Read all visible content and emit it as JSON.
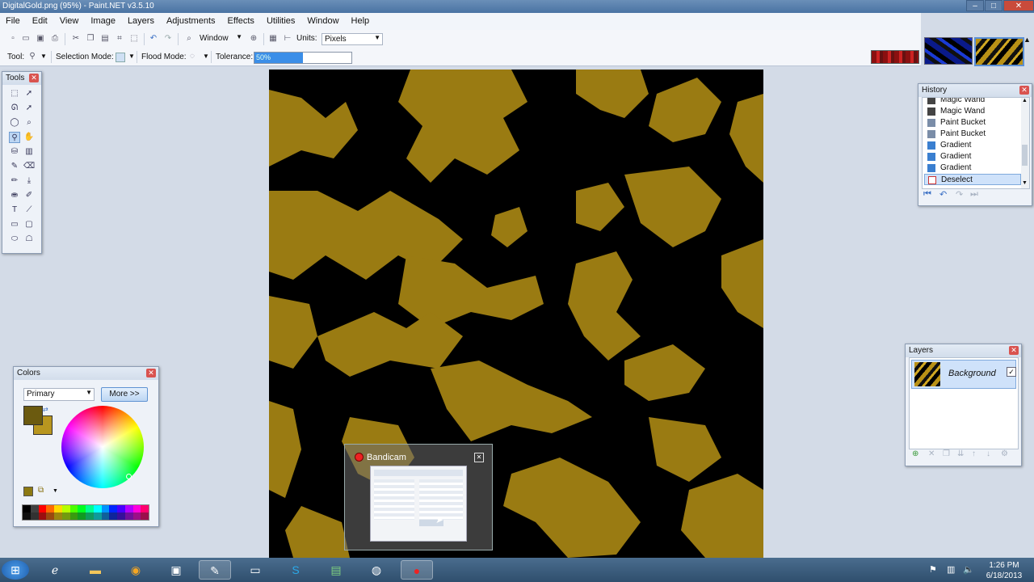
{
  "window": {
    "title": "DigitalGold.png (95%) - Paint.NET v3.5.10"
  },
  "menu": {
    "items": [
      "File",
      "Edit",
      "View",
      "Image",
      "Layers",
      "Adjustments",
      "Effects",
      "Utilities",
      "Window",
      "Help"
    ]
  },
  "toolbar": {
    "zoom_label": "Window",
    "units_label": "Units:",
    "units_value": "Pixels",
    "tool_label": "Tool:",
    "selection_mode_label": "Selection Mode:",
    "flood_mode_label": "Flood Mode:",
    "tolerance_label": "Tolerance:",
    "tolerance_value": "50%",
    "tolerance_fraction": 0.5
  },
  "tools": {
    "title": "Tools"
  },
  "history": {
    "title": "History",
    "items": [
      "Magic Wand",
      "Magic Wand",
      "Paint Bucket",
      "Paint Bucket",
      "Gradient",
      "Gradient",
      "Gradient",
      "Deselect"
    ],
    "selected_index": 7
  },
  "layers": {
    "title": "Layers",
    "items": [
      {
        "name": "Background",
        "visible": true
      }
    ]
  },
  "colors": {
    "title": "Colors",
    "mode": "Primary",
    "more_label": "More >>",
    "primary": "#6b5a0f",
    "secondary": "#b8961f",
    "palette": [
      "#000000",
      "#404040",
      "#ff0000",
      "#ff6a00",
      "#ffd800",
      "#b6ff00",
      "#4cff00",
      "#00ff21",
      "#00ff90",
      "#00ffff",
      "#0094ff",
      "#0026ff",
      "#4800ff",
      "#b200ff",
      "#ff00dc",
      "#ff006e"
    ]
  },
  "overlay": {
    "title": "Bandicam"
  },
  "canvas": {
    "blob_color": "#9a7b12",
    "background": "#000000"
  },
  "taskbar": {
    "time": "1:26 PM",
    "date": "6/18/2013"
  }
}
